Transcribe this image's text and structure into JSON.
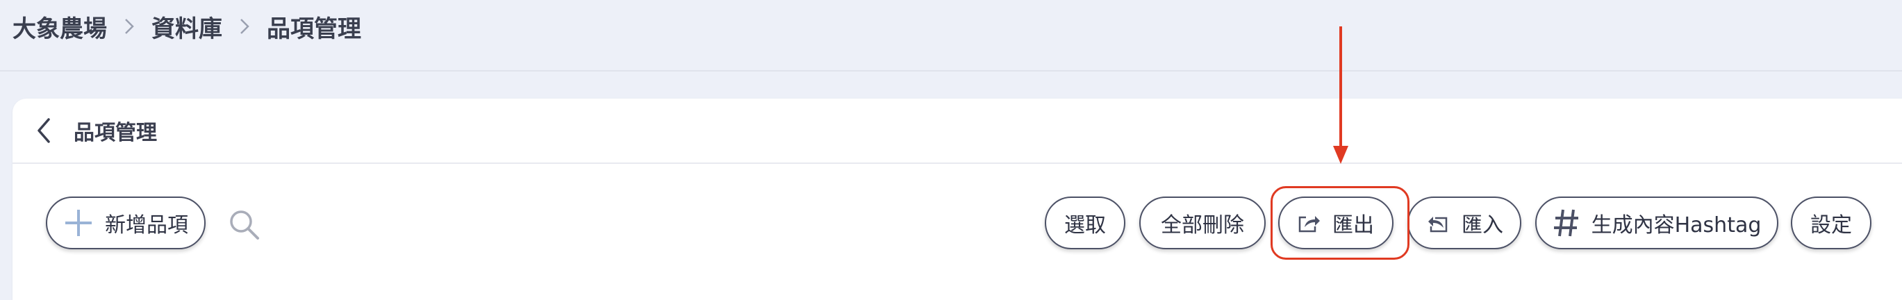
{
  "breadcrumb": [
    "大象農場",
    "資料庫",
    "品項管理"
  ],
  "card": {
    "title": "品項管理"
  },
  "toolbar": {
    "add_label": "新增品項",
    "select_label": "選取",
    "delete_all_label": "全部刪除",
    "export_label": "匯出",
    "import_label": "匯入",
    "hashtag_label": "生成內容Hashtag",
    "settings_label": "設定"
  },
  "icons": [
    "chevron-right-icon",
    "back-chevron-icon",
    "plus-icon",
    "search-icon",
    "export-icon",
    "import-icon",
    "hashtag-icon"
  ],
  "colors": {
    "accent_annotation": "#e03a22",
    "background": "#edf0f8",
    "button_border": "#4c5166",
    "plus_icon": "#9ab3d6"
  }
}
